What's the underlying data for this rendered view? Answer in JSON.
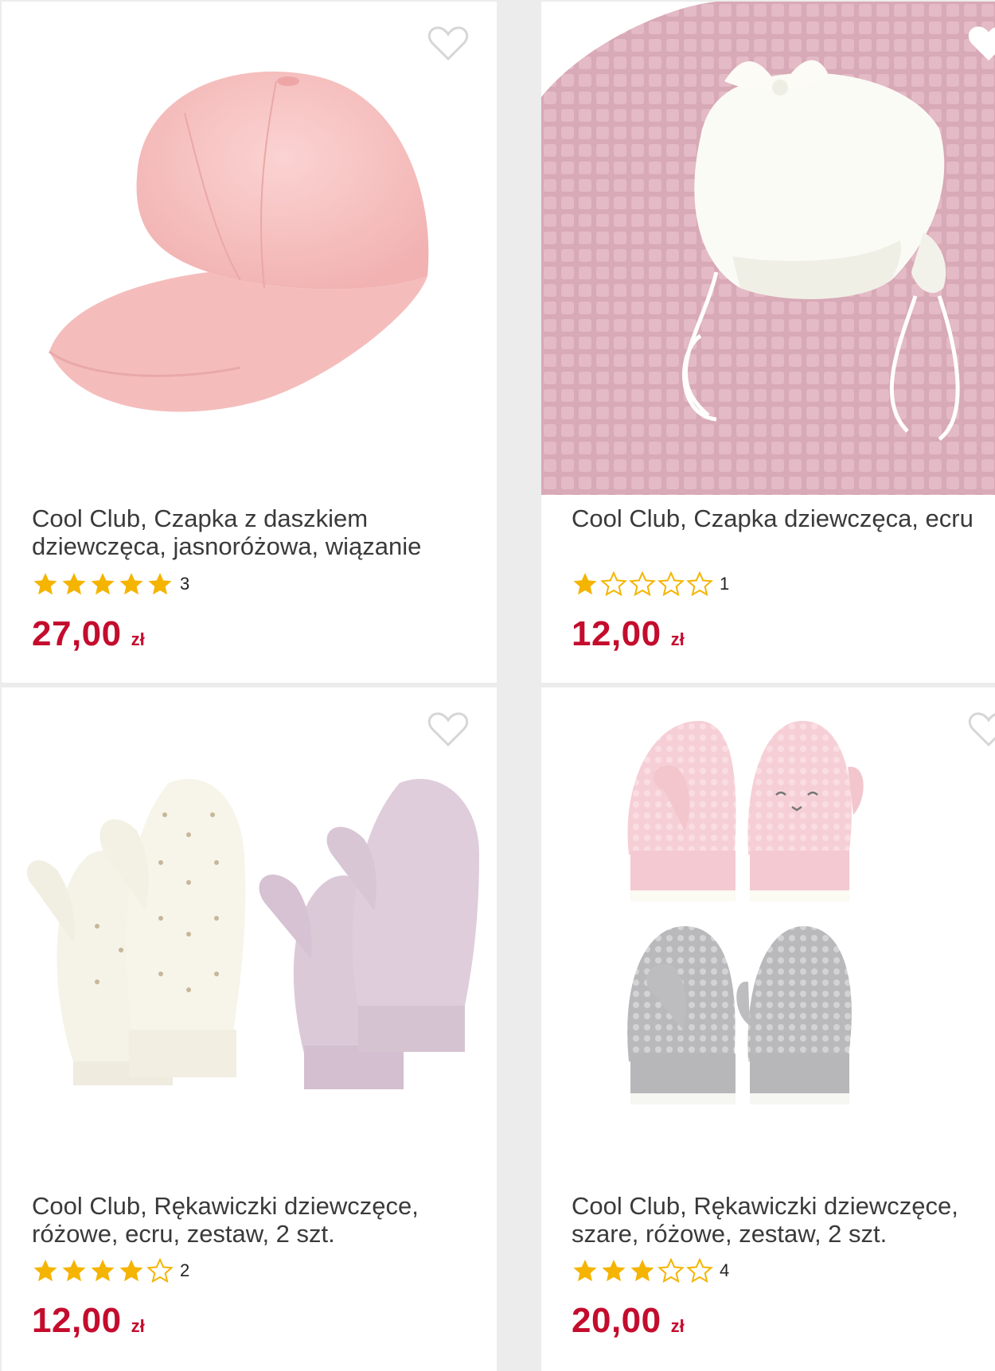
{
  "products": [
    {
      "title": "Cool Club, Czapka z daszkiem dziewczęca, jasnoróżowa, wiązanie",
      "rating_count": "3",
      "stars": 5,
      "price": "27,00",
      "currency": "zł",
      "image_icon": "pink-baseball-cap-image"
    },
    {
      "title": "Cool Club, Czapka dziewczęca, ecru",
      "rating_count": "1",
      "stars": 1,
      "price": "12,00",
      "currency": "zł",
      "image_icon": "ecru-baby-bonnet-image"
    },
    {
      "title": "Cool Club, Rękawiczki dziewczęce, różowe, ecru, zestaw, 2 szt.",
      "rating_count": "2",
      "stars": 4,
      "price": "12,00",
      "currency": "zł",
      "image_icon": "mittens-set-ecru-pink-image"
    },
    {
      "title": "Cool Club, Rękawiczki dziewczęce, szare, różowe, zestaw, 2 szt.",
      "rating_count": "4",
      "stars": 3,
      "price": "20,00",
      "currency": "zł",
      "image_icon": "mittens-set-grey-pink-image"
    }
  ],
  "colors": {
    "price": "#c40c2d",
    "star_filled": "#f5b400",
    "heart_outline": "#d6d6d6"
  }
}
